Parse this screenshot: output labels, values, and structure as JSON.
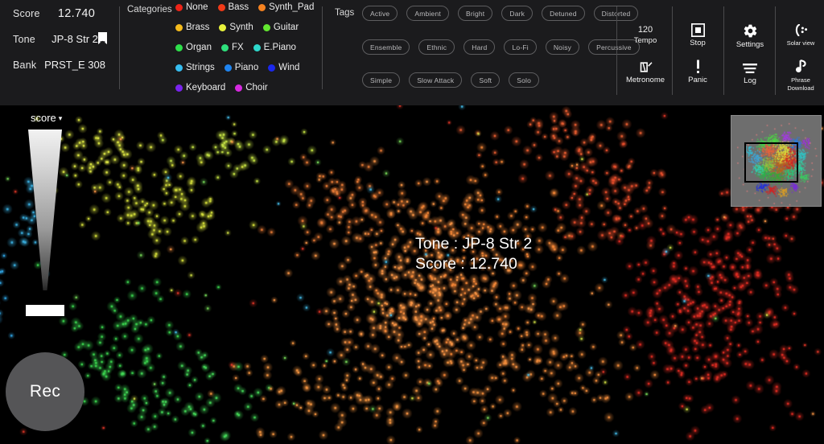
{
  "info": {
    "score_label": "Score",
    "score_value": "12.740",
    "tone_label": "Tone",
    "tone_value": "JP-8 Str 2",
    "bookmark_icon": "bookmark-icon",
    "bank_label": "Bank",
    "bank_value": "PRST_E 308"
  },
  "categories": {
    "label": "Categories",
    "rows": [
      [
        {
          "name": "None",
          "color": "#ee2418"
        },
        {
          "name": "Bass",
          "color": "#f03a18"
        },
        {
          "name": "Synth_Pad",
          "color": "#f58220"
        }
      ],
      [
        {
          "name": "Brass",
          "color": "#f5bb1c"
        },
        {
          "name": "Synth",
          "color": "#e8f23c"
        },
        {
          "name": "Guitar",
          "color": "#63e830"
        }
      ],
      [
        {
          "name": "Organ",
          "color": "#2ee04a"
        },
        {
          "name": "FX",
          "color": "#2ee07c"
        },
        {
          "name": "E.Piano",
          "color": "#2ed8cc"
        }
      ],
      [
        {
          "name": "Strings",
          "color": "#36bdf0"
        },
        {
          "name": "Piano",
          "color": "#1f84f0"
        },
        {
          "name": "Wind",
          "color": "#1b28ee"
        }
      ],
      [
        {
          "name": "Keyboard",
          "color": "#7a24ee"
        },
        {
          "name": "Choir",
          "color": "#d62ae0"
        }
      ]
    ]
  },
  "tags": {
    "label": "Tags",
    "rows": [
      [
        "Active",
        "Ambient",
        "Bright",
        "Dark",
        "Detuned",
        "Distorted"
      ],
      [
        "Ensemble",
        "Ethnic",
        "Hard",
        "Lo-Fi",
        "Noisy",
        "Percussive"
      ],
      [
        "Simple",
        "Slow Attack",
        "Soft",
        "Solo"
      ]
    ]
  },
  "toolbar": {
    "tempo_value": "120",
    "tempo_label": "Tempo",
    "metronome_label": "Metronome",
    "metronome_icon": "metronome-icon",
    "stop_label": "Stop",
    "stop_icon": "stop-icon",
    "panic_label": "Panic",
    "panic_icon": "exclamation-icon",
    "settings_label": "Settings",
    "settings_icon": "gear-icon",
    "log_label": "Log",
    "log_icon": "log-lines-icon",
    "solar_label": "Solar view",
    "solar_icon": "solar-orbit-icon",
    "phrase_label_line1": "Phrase",
    "phrase_label_line2": "Download",
    "phrase_icon": "music-note-icon"
  },
  "canvas": {
    "axis_selector": "score",
    "axis_caret": "▾",
    "rec_label": "Rec",
    "overlay_tone": "Tone : JP-8 Str 2",
    "overlay_score": "Score : 12.740"
  },
  "colors": {
    "header_bg": "#1b1b1d",
    "canvas_bg": "#000000",
    "divider": "#4a4a4c",
    "text": "#ececec",
    "tag_border": "#5d5d5f",
    "rec_bg": "#555557",
    "minimap_bg": "#6e6e6e",
    "minimap_viewport_border": "#000000"
  }
}
